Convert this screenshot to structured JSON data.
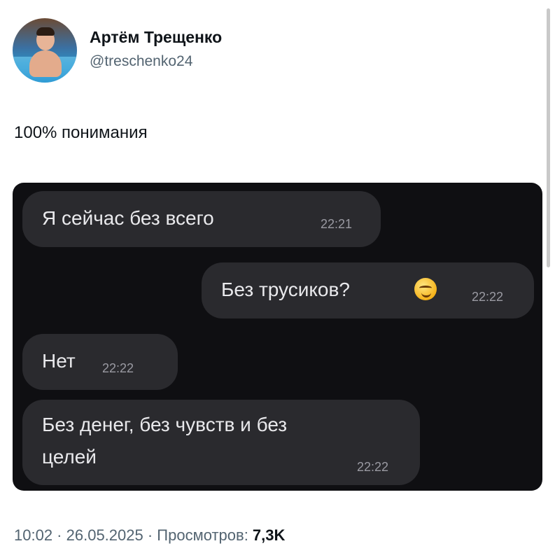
{
  "author": {
    "name": "Артём Трещенко",
    "handle": "@treschenko24"
  },
  "tweet": {
    "text": "100% понимания"
  },
  "chat": {
    "messages": [
      {
        "side": "left",
        "text": "Я сейчас без всего",
        "time": "22:21"
      },
      {
        "side": "right",
        "text": "Без трусиков?",
        "emoji": "smirking-face",
        "time": "22:22"
      },
      {
        "side": "left",
        "text": "Нет",
        "time": "22:22"
      },
      {
        "side": "left",
        "line1": "Без денег, без чувств и без",
        "line2": "целей",
        "time": "22:22"
      }
    ]
  },
  "meta": {
    "time": "10:02",
    "sep1": " · ",
    "date": "26.05.2025",
    "sep2": " · ",
    "views_label": "Просмотров: ",
    "views": "7,3K"
  },
  "colors": {
    "chat_background": "#0f0f12",
    "bubble": "#2a2a2e",
    "secondary_text": "#536471"
  }
}
